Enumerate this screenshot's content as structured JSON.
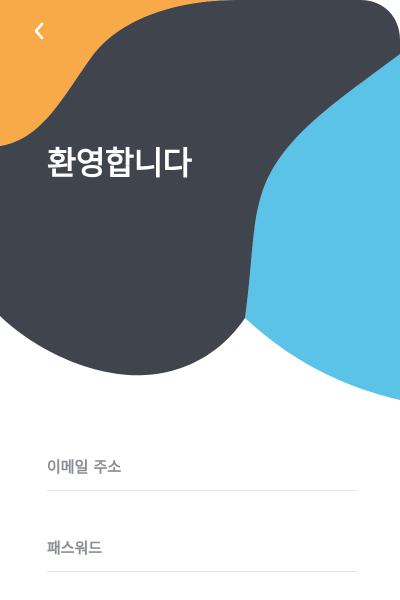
{
  "header": {
    "back_icon": "chevron-left-icon",
    "title": "환영합니다"
  },
  "form": {
    "email": {
      "value": "",
      "placeholder": "이메일 주소"
    },
    "password": {
      "value": "",
      "placeholder": "패스워드"
    }
  },
  "colors": {
    "dark_shape": "#40444d",
    "orange_shape": "#f8aa48",
    "blue_shape": "#5cc3e8",
    "title_text": "#ffffff",
    "placeholder_text": "#8a8d93",
    "divider": "#e3e4e6",
    "background": "#ffffff"
  }
}
